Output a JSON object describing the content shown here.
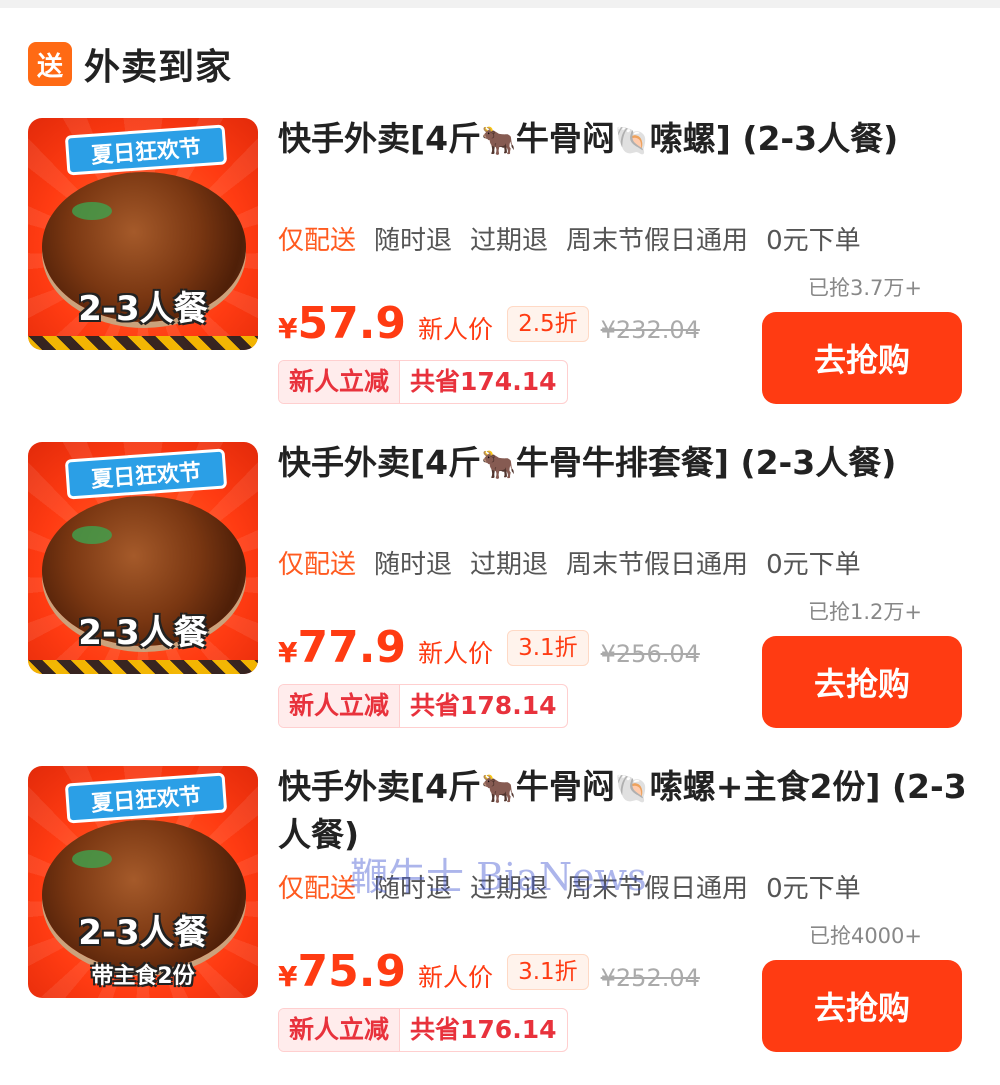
{
  "section": {
    "badge": "送",
    "title": "外卖到家"
  },
  "products": [
    {
      "title_parts": [
        "快手外卖[4斤",
        "🐂",
        "牛骨闷",
        "🐚",
        "嗦螺] (2-3人餐)"
      ],
      "thumb": {
        "ribbon": "夏日狂欢节",
        "tag": "2-3人餐",
        "sub": ""
      },
      "tags": [
        "仅配送",
        "随时退",
        "过期退",
        "周末节假日通用",
        "0元下单"
      ],
      "sold": "已抢3.7万+",
      "price_symbol": "¥",
      "price": "57.9",
      "new_user": "新人价",
      "discount": "2.5折",
      "original": "¥232.04",
      "promo_a": "新人立减",
      "promo_b": "共省174.14",
      "button": "去抢购"
    },
    {
      "title_parts": [
        "快手外卖[4斤",
        "🐂",
        "牛骨牛排套餐] (2-3人餐)",
        "",
        ""
      ],
      "thumb": {
        "ribbon": "夏日狂欢节",
        "tag": "2-3人餐",
        "sub": ""
      },
      "tags": [
        "仅配送",
        "随时退",
        "过期退",
        "周末节假日通用",
        "0元下单"
      ],
      "sold": "已抢1.2万+",
      "price_symbol": "¥",
      "price": "77.9",
      "new_user": "新人价",
      "discount": "3.1折",
      "original": "¥256.04",
      "promo_a": "新人立减",
      "promo_b": "共省178.14",
      "button": "去抢购"
    },
    {
      "title_parts": [
        "快手外卖[4斤",
        "🐂",
        "牛骨闷",
        "🐚",
        "嗦螺+主食2份] (2-3人餐)"
      ],
      "thumb": {
        "ribbon": "夏日狂欢节",
        "tag": "2-3人餐",
        "sub": "带主食2份"
      },
      "tags": [
        "仅配送",
        "随时退",
        "过期退",
        "周末节假日通用",
        "0元下单"
      ],
      "sold": "已抢4000+",
      "price_symbol": "¥",
      "price": "75.9",
      "new_user": "新人价",
      "discount": "3.1折",
      "original": "¥252.04",
      "promo_a": "新人立减",
      "promo_b": "共省176.14",
      "button": "去抢购"
    }
  ],
  "watermark": "鞭牛士 BiaNews",
  "colors": {
    "accent": "#ff3b12",
    "badge": "#ff6a14",
    "promo": "#e8323c",
    "tag_highlight": "#ff5a1f"
  }
}
